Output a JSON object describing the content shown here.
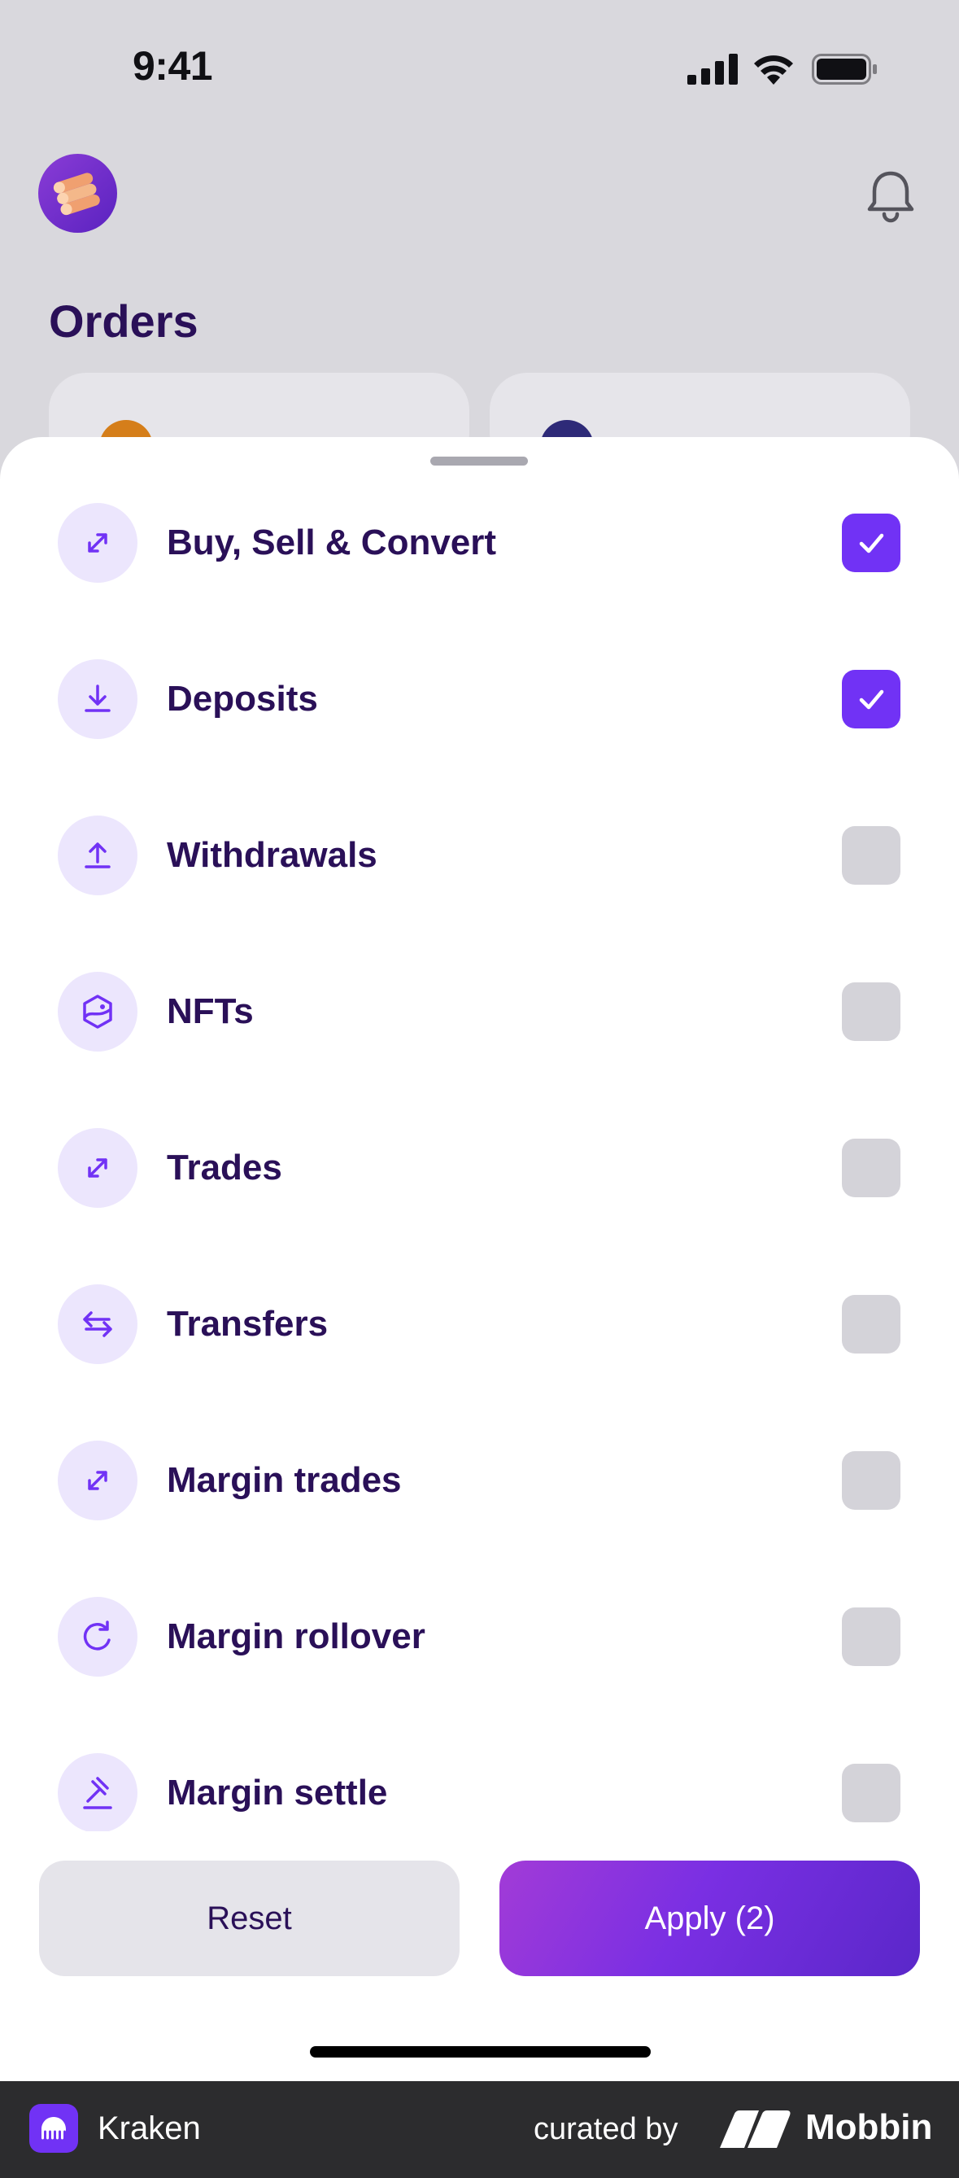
{
  "status_bar": {
    "time": "9:41",
    "icons": [
      "cellular-signal-icon",
      "wifi-icon",
      "battery-icon"
    ]
  },
  "header": {
    "avatar_icon": "coin-stack-avatar",
    "notification_icon": "bell-icon",
    "title": "Orders"
  },
  "filters": [
    {
      "label": "Buy, Sell & Convert",
      "icon": "diagonal-arrows-icon",
      "checked": true
    },
    {
      "label": "Deposits",
      "icon": "download-icon",
      "checked": true
    },
    {
      "label": "Withdrawals",
      "icon": "upload-icon",
      "checked": false
    },
    {
      "label": "NFTs",
      "icon": "nft-image-icon",
      "checked": false
    },
    {
      "label": "Trades",
      "icon": "diagonal-arrows-icon",
      "checked": false
    },
    {
      "label": "Transfers",
      "icon": "horizontal-arrows-icon",
      "checked": false
    },
    {
      "label": "Margin trades",
      "icon": "diagonal-arrows-icon",
      "checked": false
    },
    {
      "label": "Margin rollover",
      "icon": "rotate-icon",
      "checked": false
    },
    {
      "label": "Margin settle",
      "icon": "gavel-icon",
      "checked": false
    }
  ],
  "actions": {
    "reset_label": "Reset",
    "apply_label": "Apply (2)"
  },
  "footer": {
    "app_name": "Kraken",
    "curated_by": "curated by",
    "brand": "Mobbin"
  },
  "colors": {
    "accent": "#7132f5",
    "text_dark": "#2a1058",
    "icon_bg": "#ece6fd",
    "checkbox_off": "#d4d3d9"
  }
}
